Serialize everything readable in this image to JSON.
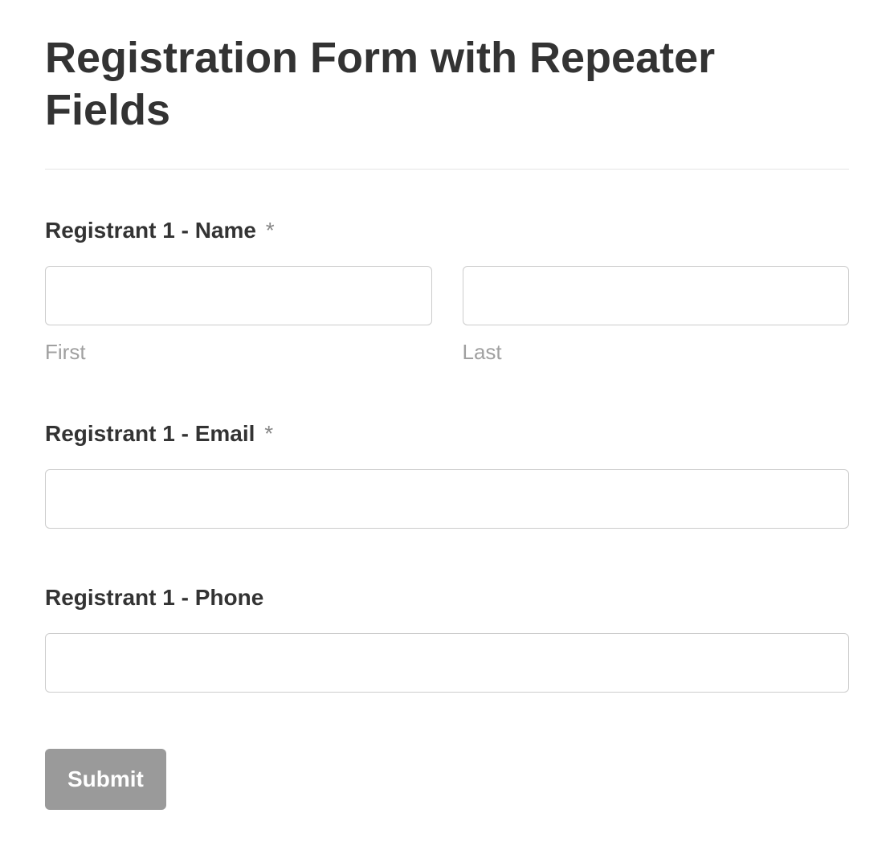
{
  "page": {
    "title": "Registration Form with Repeater Fields"
  },
  "form": {
    "fields": {
      "name": {
        "label": "Registrant 1 - Name",
        "required_marker": "*",
        "first": {
          "value": "",
          "sub_label": "First"
        },
        "last": {
          "value": "",
          "sub_label": "Last"
        }
      },
      "email": {
        "label": "Registrant 1 - Email",
        "required_marker": "*",
        "value": ""
      },
      "phone": {
        "label": "Registrant 1 - Phone",
        "value": ""
      }
    },
    "submit_label": "Submit"
  }
}
